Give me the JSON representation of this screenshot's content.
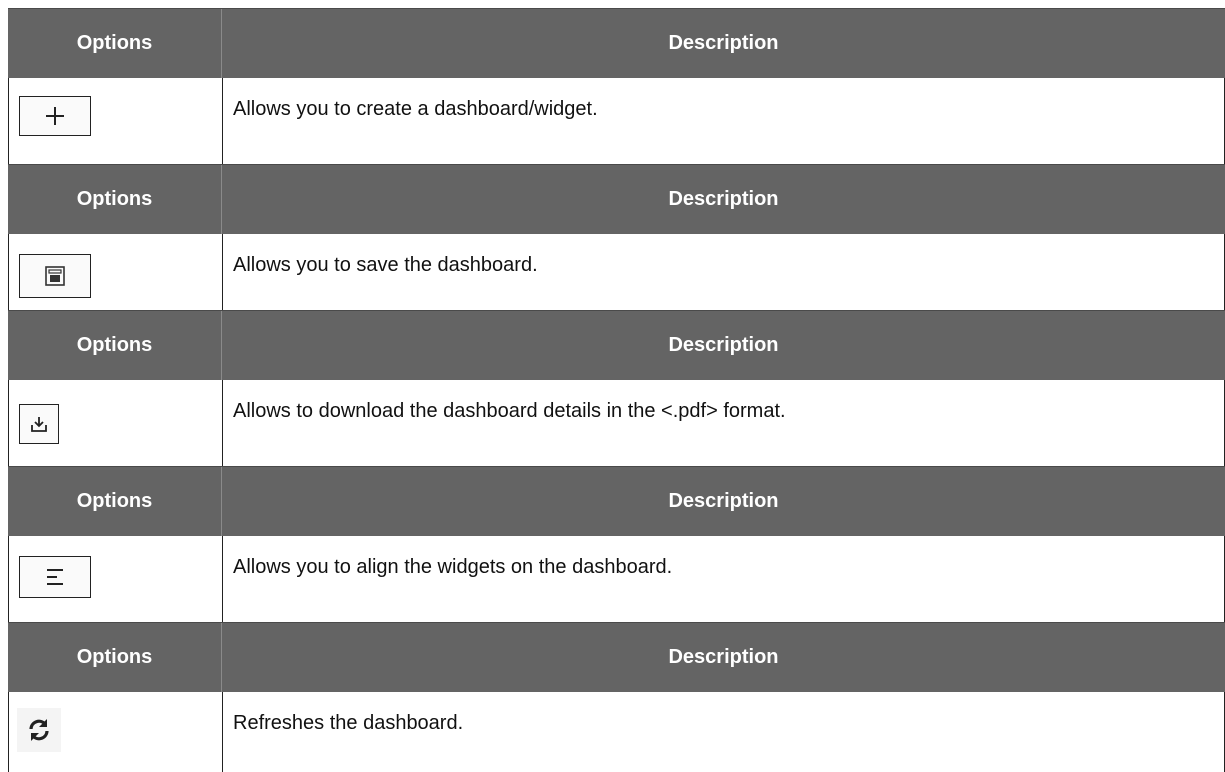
{
  "rows": [
    {
      "options_header": "Options",
      "description_header": "Description",
      "icon": "plus-icon",
      "description": "Allows you to create a dashboard/widget."
    },
    {
      "options_header": "Options",
      "description_header": "Description",
      "icon": "save-icon",
      "description": "Allows you to save the dashboard."
    },
    {
      "options_header": "Options",
      "description_header": "Description",
      "icon": "download-icon",
      "description": "Allows to download the dashboard details in the <.pdf> format."
    },
    {
      "options_header": "Options",
      "description_header": "Description",
      "icon": "align-icon",
      "description": "Allows you to align the widgets on the dashboard."
    },
    {
      "options_header": "Options",
      "description_header": "Description",
      "icon": "refresh-icon",
      "description": "Refreshes the dashboard."
    }
  ],
  "colors": {
    "header_bg": "#646464",
    "header_text": "#ffffff",
    "border": "#222222"
  }
}
